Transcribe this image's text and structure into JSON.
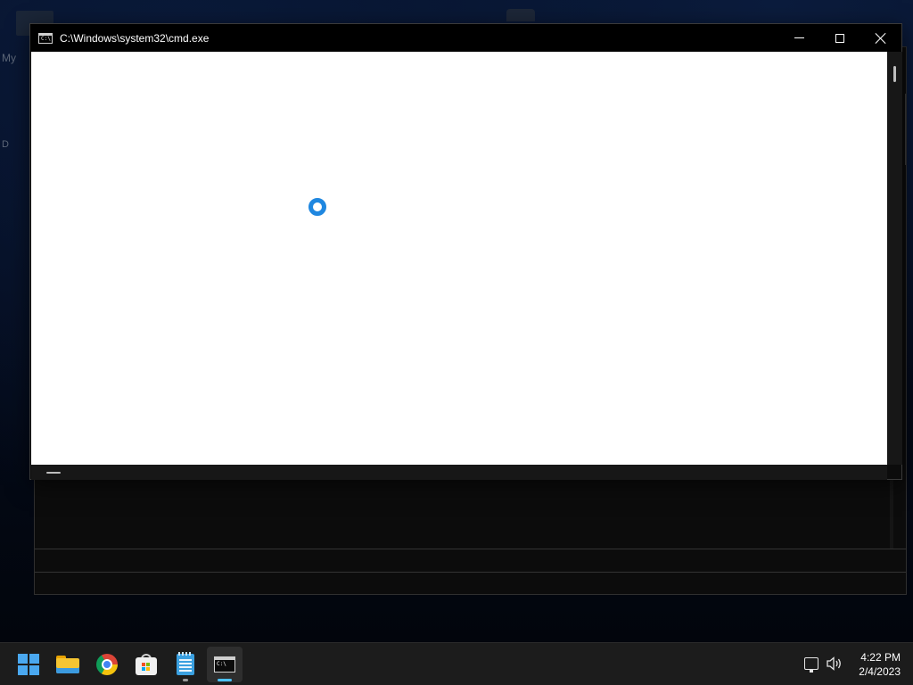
{
  "window": {
    "title": "C:\\Windows\\system32\\cmd.exe",
    "icon": "cmd-icon",
    "controls": [
      "minimize",
      "maximize",
      "close"
    ]
  },
  "desktop": {
    "labels": [
      "My",
      "D"
    ]
  },
  "console": {
    "background": "#ffffff",
    "loading_spinner_color": "#1f87e0"
  },
  "taskbar": {
    "items": [
      {
        "name": "Start",
        "icon": "windows-logo-icon",
        "state": "none"
      },
      {
        "name": "File Explorer",
        "icon": "folder-icon",
        "state": "none"
      },
      {
        "name": "Google Chrome",
        "icon": "chrome-icon",
        "state": "none"
      },
      {
        "name": "Microsoft Store",
        "icon": "store-icon",
        "state": "none"
      },
      {
        "name": "Notepad",
        "icon": "notepad-icon",
        "state": "open"
      },
      {
        "name": "Command Prompt",
        "icon": "terminal-icon",
        "state": "focused"
      }
    ],
    "tray": {
      "network_icon": "network-icon",
      "volume_icon": "volume-icon"
    },
    "clock": {
      "time": "4:22 PM",
      "date": "2/4/2023"
    },
    "accent": "#4cc2ff"
  }
}
